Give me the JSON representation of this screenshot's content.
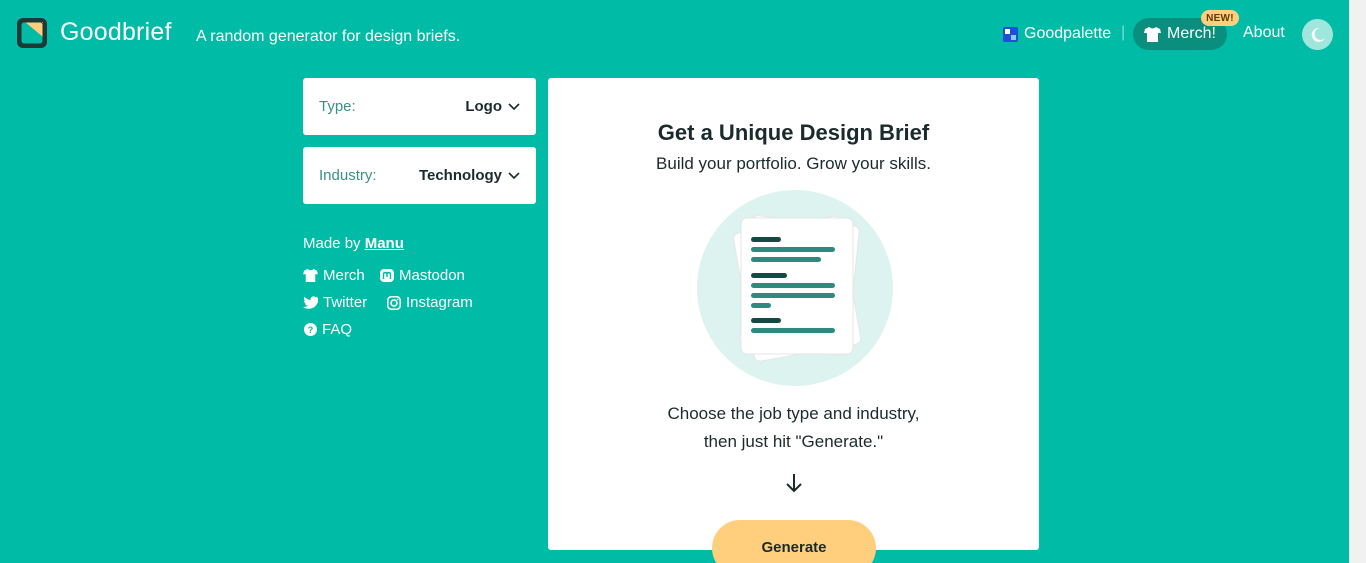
{
  "header": {
    "brand": "Goodbrief",
    "tagline": "A random generator for design briefs.",
    "nav": {
      "goodpalette": "Goodpalette",
      "separator": "|",
      "merch": "Merch!",
      "new_badge": "NEW!",
      "about": "About"
    },
    "icons": {
      "logo": "goodbrief-logo-icon",
      "goodpalette": "goodpalette-icon",
      "merch": "tshirt-icon",
      "dark_mode": "moon-icon"
    }
  },
  "controls": {
    "type": {
      "label": "Type:",
      "value": "Logo"
    },
    "industry": {
      "label": "Industry:",
      "value": "Technology"
    }
  },
  "credits": {
    "made_by": "Made by",
    "author": "Manu",
    "links": [
      {
        "label": "Merch",
        "icon": "tshirt-icon"
      },
      {
        "label": "Mastodon",
        "icon": "mastodon-icon"
      },
      {
        "label": "Twitter",
        "icon": "twitter-icon"
      },
      {
        "label": "Instagram",
        "icon": "instagram-icon"
      },
      {
        "label": "FAQ",
        "icon": "question-icon"
      }
    ]
  },
  "main": {
    "title": "Get a Unique Design Brief",
    "subtitle": "Build your portfolio. Grow your skills.",
    "instructions_line1": "Choose the job type and industry,",
    "instructions_line2": "then just hit \"Generate.\"",
    "generate_label": "Generate"
  },
  "colors": {
    "background": "#00bba5",
    "card": "#ffffff",
    "accent_button": "#ffcf7d",
    "merch_pill": "#0a8f7f",
    "text_dark": "#1b2b2b"
  }
}
